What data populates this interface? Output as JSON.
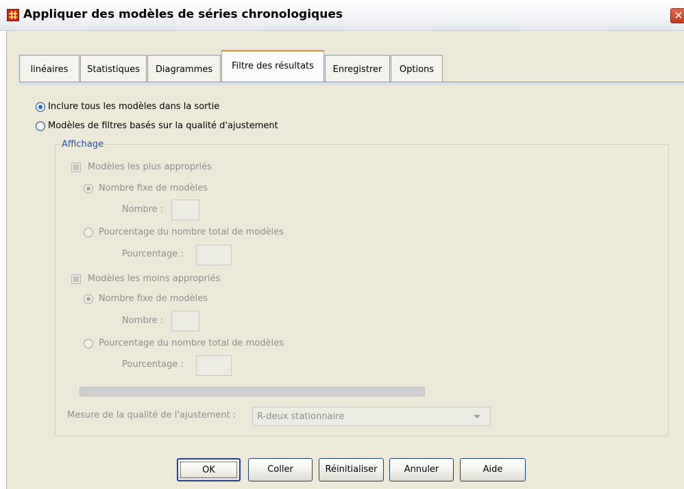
{
  "window": {
    "title": "Appliquer des modèles de séries chronologiques",
    "close_glyph": "✕",
    "icon": "spss-grid-icon"
  },
  "tabs": [
    {
      "label": "linéaires",
      "active": false
    },
    {
      "label": "Statistiques",
      "active": false
    },
    {
      "label": "Diagrammes",
      "active": false
    },
    {
      "label": "Filtre des résultats",
      "active": true
    },
    {
      "label": "Enregistrer",
      "active": false
    },
    {
      "label": "Options",
      "active": false
    }
  ],
  "output_filter": {
    "include_all": {
      "label": "Inclure tous les modèles dans la sortie",
      "selected": true
    },
    "filter_by_fit": {
      "label": "Modèles de filtres basés sur la qualité d'ajustement",
      "selected": false
    }
  },
  "display": {
    "legend": "Affichage",
    "best_models": {
      "label": "Modèles les plus appropriés",
      "checked": false,
      "fixed_number_label": "Nombre fixe de modèles",
      "fixed_number_selected": true,
      "number_label": "Nombre :",
      "number_value": "",
      "percentage_option_label": "Pourcentage du nombre total de modèles",
      "percentage_label": "Pourcentage :",
      "percentage_value": ""
    },
    "worst_models": {
      "label": "Modèles les moins appropriés",
      "checked": false,
      "fixed_number_label": "Nombre fixe de modèles",
      "fixed_number_selected": true,
      "number_label": "Nombre :",
      "number_value": "",
      "percentage_option_label": "Pourcentage du nombre total de modèles",
      "percentage_label": "Pourcentage :",
      "percentage_value": ""
    },
    "fit_measure_label": "Mesure de la qualité de l'ajustement :",
    "fit_measure_value": "R-deux stationnaire"
  },
  "buttons": {
    "ok": "OK",
    "paste": "Coller",
    "reset": "Réinitialiser",
    "cancel": "Annuler",
    "help": "Aide"
  },
  "colors": {
    "dialog_bg": "#ece9d8",
    "active_tab_accent": "#e68b2c",
    "group_legend": "#1c4fb8",
    "disabled_text": "#8f8f8f"
  }
}
